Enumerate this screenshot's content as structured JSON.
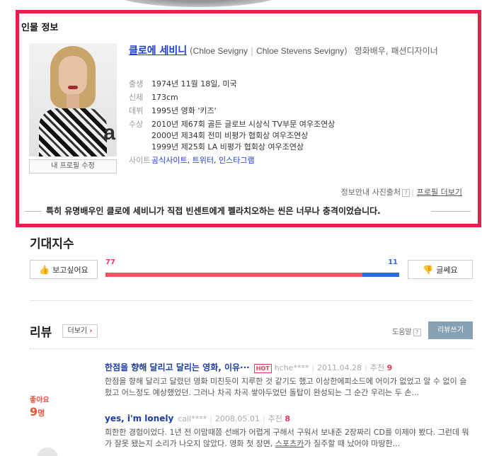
{
  "info": {
    "title": "인물 정보",
    "name_ko": "클로에 세비니",
    "name_en1": "Chloe Sevigny",
    "name_en2": "Chloe Stevens Sevigny",
    "job": "영화배우, 패션디자이너",
    "edit_label": "내 프로필 수정",
    "photo_letter": "a",
    "details": {
      "birth_label": "출생",
      "birth": "1974년 11월 18일, 미국",
      "body_label": "신체",
      "body": "173cm",
      "debut_label": "데뷔",
      "debut": "1995년 영화 '키즈'",
      "award_label": "수상",
      "awards": [
        "2010년 제67회 골든 글로브 시상식 TV부문 여우조연상",
        "2000년 제34회 전미 비평가 협회상 여우조연상",
        "1999년 제25회 LA 비평가 협회상 여우조연상"
      ],
      "site_label": "사이트",
      "sites": [
        "공식사이트",
        "트위터",
        "인스타그램"
      ]
    },
    "source_label": "정보안내 사진출처",
    "more_label": "프로필 더보기",
    "quote": "특히 유명배우인 클로에 세비니가 직접 빈센트에게 펠라치오하는 씬은 너무나 충격이었습니다."
  },
  "expect": {
    "title": "기대지수",
    "want_label": "보고싶어요",
    "want_count": "77",
    "not_count": "11",
    "want_value": 77,
    "not_value": 11,
    "write_label": "글쎄요"
  },
  "reviews": {
    "title": "리뷰",
    "more_label": "더보기",
    "help_label": "도움말",
    "write_label": "리뷰쓰기",
    "like_label": "좋아요",
    "like_count": "9",
    "like_unit": "명",
    "items": [
      {
        "title": "한점을 향해 달리고 달리는 영화, 이유···",
        "hot": "HOT",
        "author": "hche****",
        "date": "2011.04.28",
        "rec_label": "추천",
        "rec": "9",
        "body": "한점을 향해 달리고 달렸던 영화 미친듯이 지루한 것 같기도 했고 이상한에피소드에 어이가 없었고 알 수 없이 슬펐고 어느정도 예상했었던. 그러나 차곡 차곡 쌓아두었던 돌탑이 완성되는 그 순간 우리는 두 손..."
      },
      {
        "title": "yes, i'm lonely",
        "author": "call****",
        "date": "2008.05.01",
        "rec_label": "추천",
        "rec": "8",
        "body_pre": "희한한 경험이었다. 1년 전 이맘때쯤 선배가 어렵게 구해서 구워서 보내준 2장짜리 CD를 이제야 봤다. 그런데 뭐가 잘못 됐는지 소리가 나오지 않았다. 영화 첫 장면, ",
        "body_link": "스포츠카",
        "body_post": "가 질주할 때 났어야 마땅한..."
      }
    ]
  },
  "colors": {
    "accent": "#e91e4b",
    "blue": "#2e6be0",
    "red": "#f0565e",
    "link": "#1c3bd4"
  }
}
